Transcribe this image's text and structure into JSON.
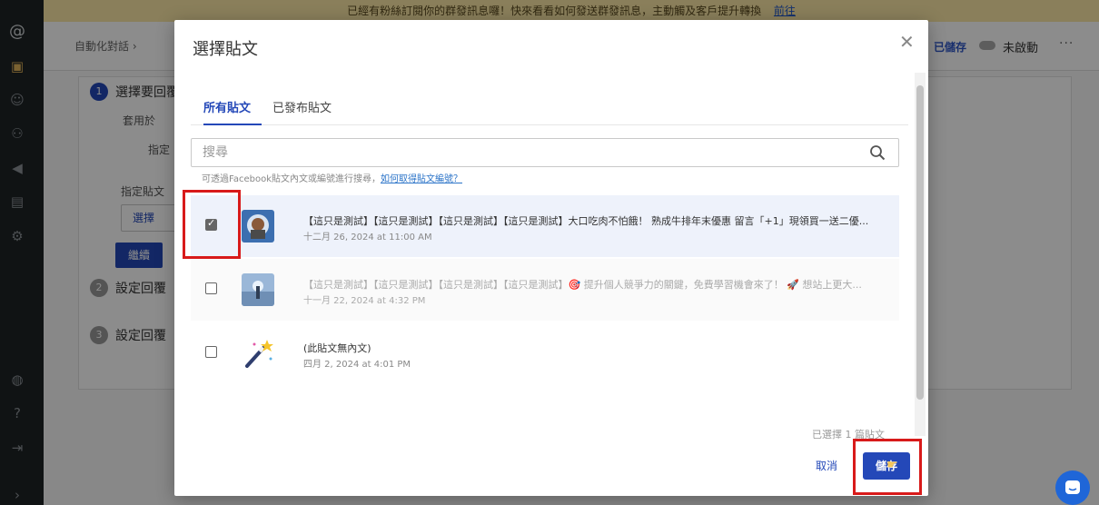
{
  "banner": {
    "text": "已經有粉絲訂閱你的群發訊息囉！快來看看如何發送群發訊息，主動觸及客戶提升轉換",
    "link": "前往"
  },
  "background": {
    "breadcrumb": "自動化對話 ›",
    "saved": "已儲存",
    "status": "未啟動",
    "more": "···",
    "step1": {
      "num": "1",
      "label": "選擇要回覆"
    },
    "apply_label": "套用於",
    "radio_label": "指定",
    "assign_label": "指定貼文",
    "select_btn": "選擇",
    "continue_btn": "繼續",
    "step2": {
      "num": "2",
      "label": "設定回覆"
    },
    "step3": {
      "num": "3",
      "label": "設定回覆"
    }
  },
  "modal": {
    "title": "選擇貼文",
    "tabs": [
      {
        "label": "所有貼文",
        "active": true
      },
      {
        "label": "已發布貼文",
        "active": false
      }
    ],
    "search": {
      "placeholder": "搜尋"
    },
    "hint": "可透過Facebook貼文內文或編號進行搜尋，",
    "hint_link": "如何取得貼文編號？",
    "posts": [
      {
        "text": "【這只是測試】【這只是測試】【這只是測試】【這只是測試】大口吃肉不怕餓！ 熟成牛排年末優惠 留言「+1」現領買一送二優...",
        "date": "十二月 26, 2024 at 11:00 AM",
        "checked": true
      },
      {
        "text": "【這只是測試】【這只是測試】【這只是測試】【這只是測試】🎯 提升個人競爭力的關鍵，免費學習機會來了！ 🚀 想站上更大...",
        "date": "十一月 22, 2024 at 4:32 PM",
        "checked": false
      },
      {
        "text": "(此貼文無內文)",
        "date": "四月 2, 2024 at 4:01 PM",
        "checked": false
      }
    ],
    "selected_count": "已選擇 1 篇貼文",
    "cancel": "取消",
    "save": "儲存"
  },
  "colors": {
    "accent": "#2448b8",
    "highlight": "#d81a1a",
    "banner": "#fbe8a6"
  }
}
